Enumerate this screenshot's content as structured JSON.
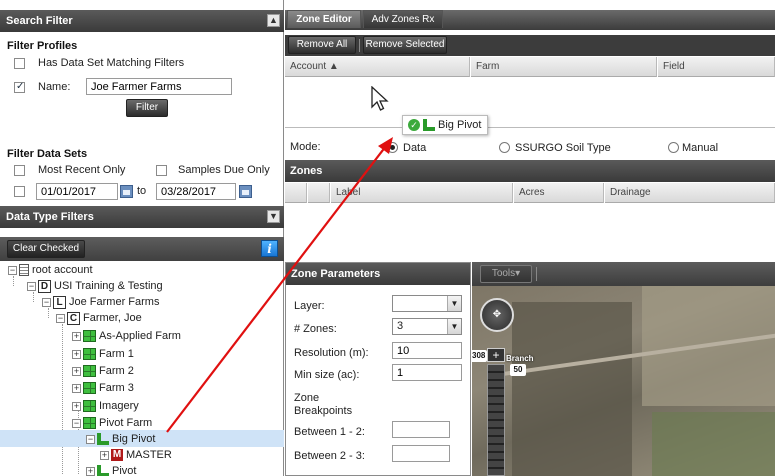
{
  "search_filter": {
    "title": "Search Filter",
    "profiles_title": "Filter Profiles",
    "has_data_set_label": "Has Data Set Matching Filters",
    "name_label": "Name:",
    "name_value": "Joe Farmer Farms",
    "filter_button": "Filter",
    "data_sets_title": "Filter Data Sets",
    "most_recent_label": "Most Recent Only",
    "samples_due_label": "Samples Due Only",
    "date_from": "01/01/2017",
    "to_label": "to",
    "date_to": "03/28/2017"
  },
  "data_type_filters": {
    "title": "Data Type Filters",
    "clear_checked": "Clear Checked",
    "info_icon": "i"
  },
  "tree": {
    "root": "root account",
    "level1": "USI Training & Testing",
    "level2": "Joe Farmer Farms",
    "level3": "Farmer, Joe",
    "farms": [
      "As-Applied Farm",
      "Farm 1",
      "Farm 2",
      "Farm 3",
      "Imagery",
      "Pivot Farm"
    ],
    "selected_field": "Big Pivot",
    "master": "MASTER",
    "pivot": "Pivot",
    "letters": {
      "d": "D",
      "l": "L",
      "c": "C",
      "m": "M"
    }
  },
  "zone_editor": {
    "tabs": [
      "Zone Editor",
      "Adv Zones Rx"
    ],
    "remove_all": "Remove All",
    "remove_selected": "Remove Selected",
    "columns": [
      "Account ▲",
      "Farm",
      "Field"
    ],
    "drag_label": "Big Pivot",
    "mode_label": "Mode:",
    "modes": [
      "Data",
      "SSURGO Soil Type",
      "Manual"
    ],
    "zones_title": "Zones",
    "zone_columns": [
      "Label",
      "Acres",
      "Drainage"
    ]
  },
  "zone_parameters": {
    "title": "Zone Parameters",
    "layer_label": "Layer:",
    "layer_value": "",
    "zones_label": "# Zones:",
    "zones_value": "3",
    "resolution_label": "Resolution (m):",
    "resolution_value": "10",
    "min_size_label": "Min size (ac):",
    "min_size_value": "1",
    "breakpoints_line1": "Zone",
    "breakpoints_line2": "Breakpoints",
    "between12_label": "Between 1 - 2:",
    "between23_label": "Between 2 - 3:"
  },
  "map": {
    "tools_label": "Tools▾",
    "zoom_label": "308",
    "branch_label": "Branch",
    "road_label": "50"
  },
  "colors": {
    "header_dark": "#3a3a3a",
    "selection": "#cfe3f7",
    "arrow": "#e01010"
  }
}
